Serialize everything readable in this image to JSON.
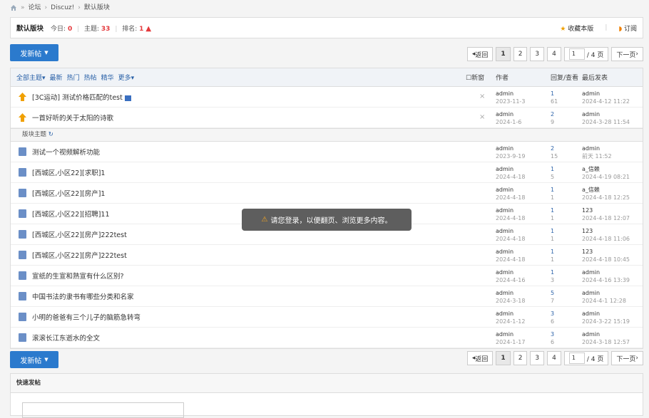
{
  "breadcrumb": [
    "论坛",
    "Discuz!",
    "默认版块"
  ],
  "forum": {
    "name": "默认版块",
    "today_label": "今日:",
    "today": "0",
    "topics_label": "主题:",
    "topics": "33",
    "rank_label": "排名:",
    "rank": "1",
    "favorite": "收藏本版",
    "subscribe": "订阅"
  },
  "post_button": "发新帖",
  "pager": {
    "back": "返回",
    "pages": [
      "1",
      "2",
      "3",
      "4"
    ],
    "input": "1",
    "total": "/ 4 页",
    "next": "下一页"
  },
  "filters": [
    "全部主题",
    "最新",
    "热门",
    "热帖",
    "精华",
    "更多"
  ],
  "columns": {
    "newwin": "新窗",
    "author": "作者",
    "replies": "回复/查看",
    "last": "最后发表"
  },
  "section_label": "版块主题",
  "pinned": [
    {
      "title": "[3C运动] 测试价格匹配的test",
      "author": "admin",
      "date": "2023-11-3",
      "replies": "1",
      "views": "61",
      "last_user": "admin",
      "last_date": "2024-4-12 11:22"
    },
    {
      "title": "一首好听的关于太阳的诗歌",
      "author": "admin",
      "date": "2024-1-6",
      "replies": "2",
      "views": "9",
      "last_user": "admin",
      "last_date": "2024-3-28 11:54"
    }
  ],
  "threads": [
    {
      "title": "测试一个视频解析功能",
      "author": "admin",
      "date": "2023-9-19",
      "replies": "2",
      "views": "15",
      "last_user": "admin",
      "last_date": "前天 11:52"
    },
    {
      "title": "[西城区,小区22][求职]1",
      "author": "admin",
      "date": "2024-4-18",
      "replies": "1",
      "views": "5",
      "last_user": "a_信赖",
      "last_date": "2024-4-19 08:21"
    },
    {
      "title": "[西城区,小区22][房产]1",
      "author": "admin",
      "date": "2024-4-18",
      "replies": "1",
      "views": "1",
      "last_user": "a_信赖",
      "last_date": "2024-4-18 12:25"
    },
    {
      "title": "[西城区,小区22][招聘]11",
      "author": "admin",
      "date": "2024-4-18",
      "replies": "1",
      "views": "1",
      "last_user": "123",
      "last_date": "2024-4-18 12:07"
    },
    {
      "title": "[西城区,小区22][房产]222test",
      "author": "admin",
      "date": "2024-4-18",
      "replies": "1",
      "views": "1",
      "last_user": "123",
      "last_date": "2024-4-18 11:06"
    },
    {
      "title": "[西城区,小区22][房产]222test",
      "author": "admin",
      "date": "2024-4-18",
      "replies": "1",
      "views": "1",
      "last_user": "123",
      "last_date": "2024-4-18 10:45"
    },
    {
      "title": "宣纸的生宣和熟宣有什么区别?",
      "author": "admin",
      "date": "2024-4-16",
      "replies": "1",
      "views": "3",
      "last_user": "admin",
      "last_date": "2024-4-16 13:39"
    },
    {
      "title": "中国书法的隶书有哪些分类和名家",
      "author": "admin",
      "date": "2024-3-18",
      "replies": "5",
      "views": "7",
      "last_user": "admin",
      "last_date": "2024-4-1 12:28"
    },
    {
      "title": "小明的爸爸有三个儿子的脑筋急转弯",
      "author": "admin",
      "date": "2024-1-12",
      "replies": "3",
      "views": "6",
      "last_user": "admin",
      "last_date": "2024-3-22 15:19"
    },
    {
      "title": "滚滚长江东逝水的全文",
      "author": "admin",
      "date": "2024-1-17",
      "replies": "3",
      "views": "6",
      "last_user": "admin",
      "last_date": "2024-3-18 12:57"
    }
  ],
  "toast": "请您登录，以便翻页、浏览更多内容。",
  "quick_post": "快速发帖",
  "colors": {
    "accent": "#2b7acd",
    "highlight": "#e4393c",
    "link": "#2b62a8"
  }
}
